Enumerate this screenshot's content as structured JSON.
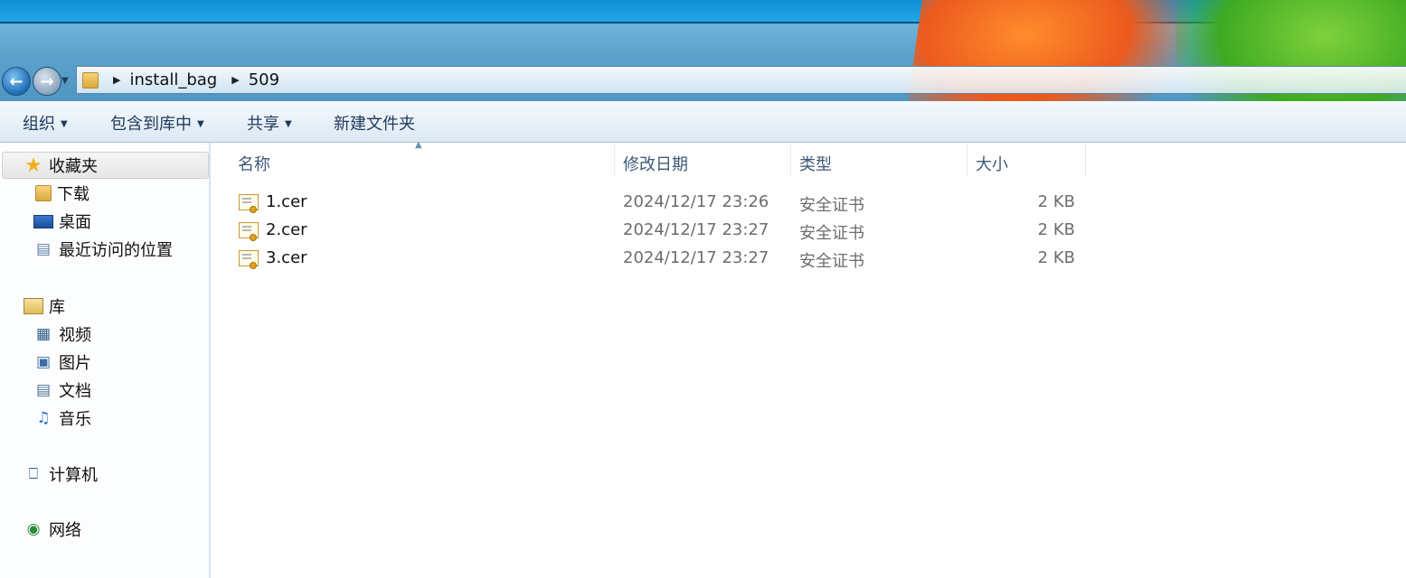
{
  "address": {
    "path": [
      "install_bag",
      "509"
    ]
  },
  "toolbar": {
    "organize": "组织",
    "include_in_library": "包含到库中",
    "share": "共享",
    "new_folder": "新建文件夹"
  },
  "sidebar": {
    "favorites": {
      "label": "收藏夹",
      "items": [
        "下载",
        "桌面",
        "最近访问的位置"
      ]
    },
    "libraries": {
      "label": "库",
      "items": [
        "视频",
        "图片",
        "文档",
        "音乐"
      ]
    },
    "computer": "计算机",
    "network": "网络"
  },
  "columns": {
    "name": "名称",
    "date": "修改日期",
    "type": "类型",
    "size": "大小"
  },
  "files": [
    {
      "name": "1.cer",
      "date": "2024/12/17 23:26",
      "type": "安全证书",
      "size": "2 KB"
    },
    {
      "name": "2.cer",
      "date": "2024/12/17 23:27",
      "type": "安全证书",
      "size": "2 KB"
    },
    {
      "name": "3.cer",
      "date": "2024/12/17 23:27",
      "type": "安全证书",
      "size": "2 KB"
    }
  ],
  "icons": {
    "back": "back-arrow-icon",
    "forward": "forward-arrow-icon",
    "file": "certificate-icon"
  }
}
